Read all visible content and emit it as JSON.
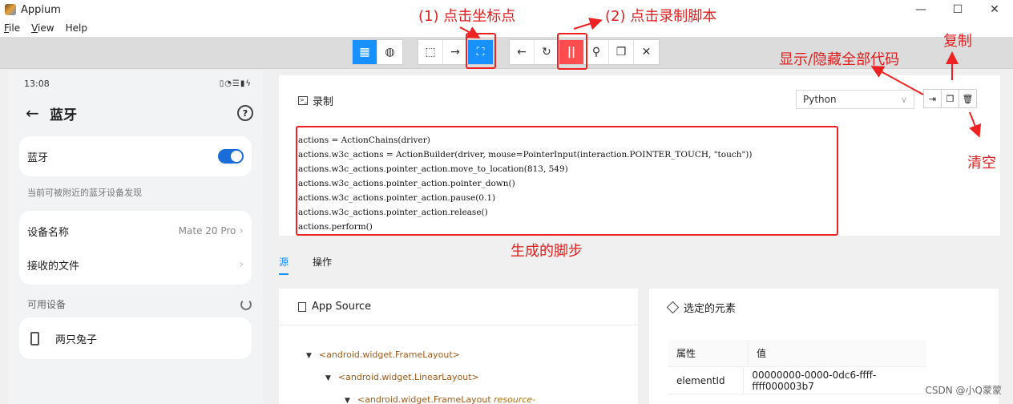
{
  "app": {
    "title": "Appium"
  },
  "window_controls": {
    "minimize": "—",
    "maximize": "☐",
    "close": "✕"
  },
  "menu": [
    {
      "key": "F",
      "rest": "ile"
    },
    {
      "key": "V",
      "rest": "iew"
    },
    {
      "key": "",
      "rest": "Help"
    }
  ],
  "toolbar": {
    "group1": [
      {
        "icon": "grid-icon",
        "glyph": "▦"
      },
      {
        "icon": "globe-icon",
        "glyph": "◍"
      }
    ],
    "group2": [
      {
        "icon": "select-icon",
        "glyph": "⬚"
      },
      {
        "icon": "swipe-icon",
        "glyph": "→"
      },
      {
        "icon": "tap-coordinates-icon",
        "glyph": "⛶"
      }
    ],
    "group3": [
      {
        "icon": "back-icon",
        "glyph": "←"
      },
      {
        "icon": "refresh-icon",
        "glyph": "↻"
      },
      {
        "icon": "pause-record-icon",
        "glyph": "||"
      },
      {
        "icon": "search-icon",
        "glyph": "⚲"
      },
      {
        "icon": "copy-xml-icon",
        "glyph": "❐"
      },
      {
        "icon": "quit-icon",
        "glyph": "✕"
      }
    ]
  },
  "phone": {
    "time": "13:08",
    "status_icons": "▯◔☰▮ϟ",
    "title": "蓝牙",
    "help": "?",
    "bluetooth_label": "蓝牙",
    "bluetooth_on": true,
    "discover_hint": "当前可被附近的蓝牙设备发现",
    "device_name_label": "设备名称",
    "device_name_value": "Mate 20 Pro",
    "received_files_label": "接收的文件",
    "available_label": "可用设备",
    "paired_device": "两只兔子"
  },
  "recorder": {
    "title": "录制",
    "language": "Python",
    "code_lines": [
      "actions = ActionChains(driver)",
      "actions.w3c_actions = ActionBuilder(driver, mouse=PointerInput(interaction.POINTER_TOUCH, \"touch\"))",
      "actions.w3c_actions.pointer_action.move_to_location(813, 549)",
      "actions.w3c_actions.pointer_action.pointer_down()",
      "actions.w3c_actions.pointer_action.pause(0.1)",
      "actions.w3c_actions.pointer_action.release()",
      "actions.perform()"
    ],
    "actions": [
      {
        "icon": "show-all-code-icon",
        "glyph": "⇥"
      },
      {
        "icon": "copy-icon",
        "glyph": "❐"
      },
      {
        "icon": "clear-icon",
        "glyph": "🗑"
      }
    ]
  },
  "tabs": [
    {
      "label": "源",
      "active": true
    },
    {
      "label": "操作",
      "active": false
    }
  ],
  "source": {
    "title": "App Source",
    "nodes": [
      {
        "text": "<android.widget.FrameLayout>",
        "attr": ""
      },
      {
        "text": "<android.widget.LinearLayout>",
        "attr": ""
      },
      {
        "text": "<android.widget.FrameLayout ",
        "attr": "resource-"
      }
    ]
  },
  "selected": {
    "title": "选定的元素",
    "headers": [
      "属性",
      "值"
    ],
    "rows": [
      {
        "name": "elementId",
        "value": "00000000-0000-0dc6-ffff-ffff000003b7"
      }
    ]
  },
  "annotations": {
    "tap_coords": "(1) 点击坐标点",
    "record": "(2) 点击录制脚本",
    "show_code": "显示/隐藏全部代码",
    "copy": "复制",
    "clear": "清空",
    "generated": "生成的脚步"
  },
  "watermark": "CSDN @小Q蒙蒙",
  "colors": {
    "accent": "#1890ff",
    "record": "#ff4d4f",
    "annotation": "#ee2222"
  }
}
